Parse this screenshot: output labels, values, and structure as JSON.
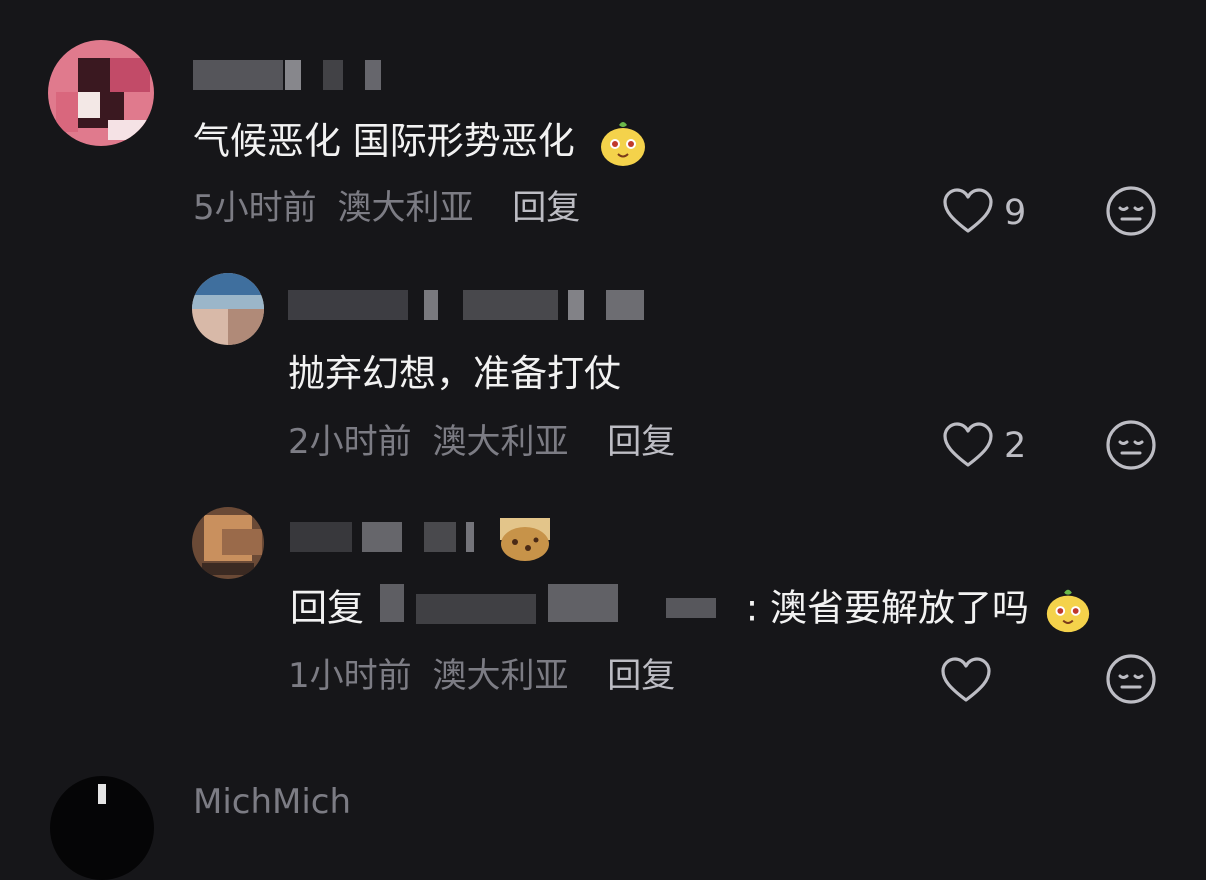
{
  "comments": [
    {
      "text": "气候恶化 国际形势恶化",
      "meta_time": "5小时前",
      "meta_location": "澳大利亚",
      "reply_label": "回复",
      "like_count": "9",
      "emoji": "mango-face-emoji"
    },
    {
      "text": "抛弃幻想，准备打仗",
      "meta_time": "2小时前",
      "meta_location": "澳大利亚",
      "reply_label": "回复",
      "like_count": "2"
    },
    {
      "reply_prefix": "回复",
      "text_suffix": ": 澳省要解放了吗",
      "meta_time": "1小时前",
      "meta_location": "澳大利亚",
      "reply_label": "回复",
      "like_count": "",
      "emoji": "mango-face-emoji"
    }
  ],
  "partial_user": {
    "name": "MichMich"
  },
  "icons": {
    "like": "heart-outline-icon",
    "dislike": "meh-face-icon"
  },
  "colors": {
    "background": "#161619",
    "text": "#f2f2f2",
    "meta": "#7c7c84",
    "accent_gray": "#bdbdc4"
  }
}
